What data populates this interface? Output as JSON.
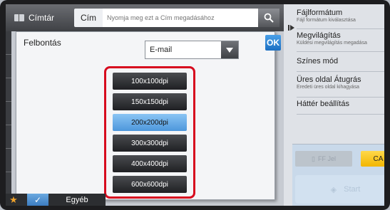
{
  "topbar": {
    "address_book_label": "Címtár",
    "to_label": "Cím",
    "address_placeholder": "Nyomja meg ezt a Cím megadásához"
  },
  "modal": {
    "resolution_label": "Felbontás",
    "format_selected": "E-mail",
    "ok_label": "OK",
    "dpi_options": [
      "100x100dpi",
      "150x150dpi",
      "200x200dpi",
      "300x300dpi",
      "400x400dpi",
      "600x600dpi"
    ],
    "selected_index": 2
  },
  "bottombar": {
    "other_label": "Egyéb"
  },
  "rightpanel": {
    "items": [
      {
        "title": "Fájlformátum",
        "sub": "Fájl formátum kiválasztása"
      },
      {
        "title": "Megvilágítás",
        "sub": "Küldési megvilágítás megadása"
      },
      {
        "title": "Színes mód",
        "sub": ""
      },
      {
        "title": "Üres oldal Átugrás",
        "sub": "Eredeti üres oldal kihagyása"
      },
      {
        "title": "Háttér beállítás",
        "sub": ""
      }
    ],
    "ff_label": "FF Jel",
    "ca_label": "CA",
    "start_label": "Start"
  },
  "colors": {
    "accent_blue": "#4d97dc",
    "highlight_red": "#d70a1e",
    "ca_yellow": "#f2b600"
  }
}
